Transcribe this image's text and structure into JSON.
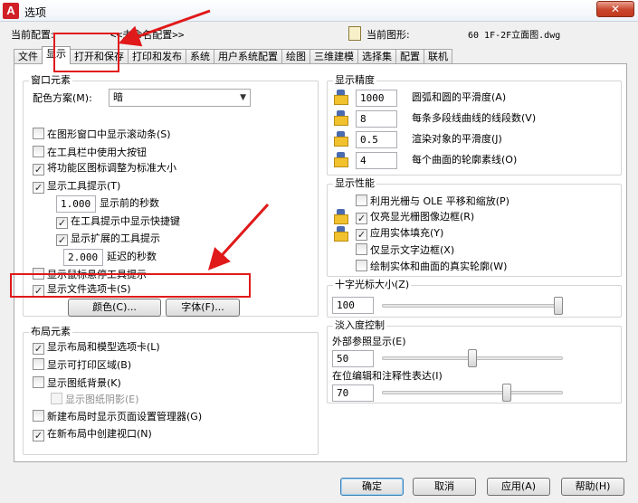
{
  "window": {
    "title": "选项",
    "app_icon": "A",
    "close": "✕"
  },
  "header": {
    "profile_label": "当前配置:",
    "profile_value": "<<未命名配置>>",
    "drawing_label": "当前图形:",
    "drawing_value": "60 1F-2F立面图.dwg"
  },
  "tabs": [
    "文件",
    "显示",
    "打开和保存",
    "打印和发布",
    "系统",
    "用户系统配置",
    "绘图",
    "三维建模",
    "选择集",
    "配置",
    "联机"
  ],
  "window_elements": {
    "title": "窗口元素",
    "color_scheme_label": "配色方案(M):",
    "color_scheme_value": "暗",
    "show_scrollbars": "在图形窗口中显示滚动条(S)",
    "large_buttons": "在工具栏中使用大按钮",
    "resize_ribbon_icons": "将功能区图标调整为标准大小",
    "show_tooltips": "显示工具提示(T)",
    "tooltip_delay_value": "1.000",
    "tooltip_delay_label": "显示前的秒数",
    "show_shortcut_keys": "在工具提示中显示快捷键",
    "show_extended_tooltips": "显示扩展的工具提示",
    "extended_delay_value": "2.000",
    "extended_delay_label": "延迟的秒数",
    "rollover_tooltips": "显示鼠标悬停工具提示",
    "file_tabs": "显示文件选项卡(S)",
    "colors_button": "颜色(C)...",
    "fonts_button": "字体(F)..."
  },
  "layout_elements": {
    "title": "布局元素",
    "layout_model_tabs": "显示布局和模型选项卡(L)",
    "printable_area": "显示可打印区域(B)",
    "paper_background": "显示图纸背景(K)",
    "paper_shadow": "显示图纸阴影(E)",
    "page_setup_manager": "新建布局时显示页面设置管理器(G)",
    "create_viewport": "在新布局中创建视口(N)"
  },
  "display_resolution": {
    "title": "显示精度",
    "items": [
      {
        "value": "1000",
        "label": "圆弧和圆的平滑度(A)"
      },
      {
        "value": "8",
        "label": "每条多段线曲线的线段数(V)"
      },
      {
        "value": "0.5",
        "label": "渲染对象的平滑度(J)"
      },
      {
        "value": "4",
        "label": "每个曲面的轮廓素线(O)"
      }
    ]
  },
  "display_performance": {
    "title": "显示性能",
    "items": [
      {
        "label": "利用光栅与 OLE 平移和缩放(P)",
        "checked": false
      },
      {
        "label": "仅亮显光栅图像边框(R)",
        "checked": true
      },
      {
        "label": "应用实体填充(Y)",
        "checked": true
      },
      {
        "label": "仅显示文字边框(X)",
        "checked": false
      },
      {
        "label": "绘制实体和曲面的真实轮廓(W)",
        "checked": false
      }
    ]
  },
  "crosshair": {
    "title": "十字光标大小(Z)",
    "value": "100",
    "level_fraction": 1.0
  },
  "fade_control": {
    "title": "淡入度控制",
    "xref_label": "外部参照显示(E)",
    "xref_value": "50",
    "xref_fraction": 0.5,
    "inplace_label": "在位编辑和注释性表达(I)",
    "inplace_value": "70",
    "inplace_fraction": 0.7
  },
  "buttons": {
    "ok": "确定",
    "cancel": "取消",
    "apply": "应用(A)",
    "help": "帮助(H)"
  },
  "checkmark": "✓",
  "highlight_color": "#e0191a"
}
